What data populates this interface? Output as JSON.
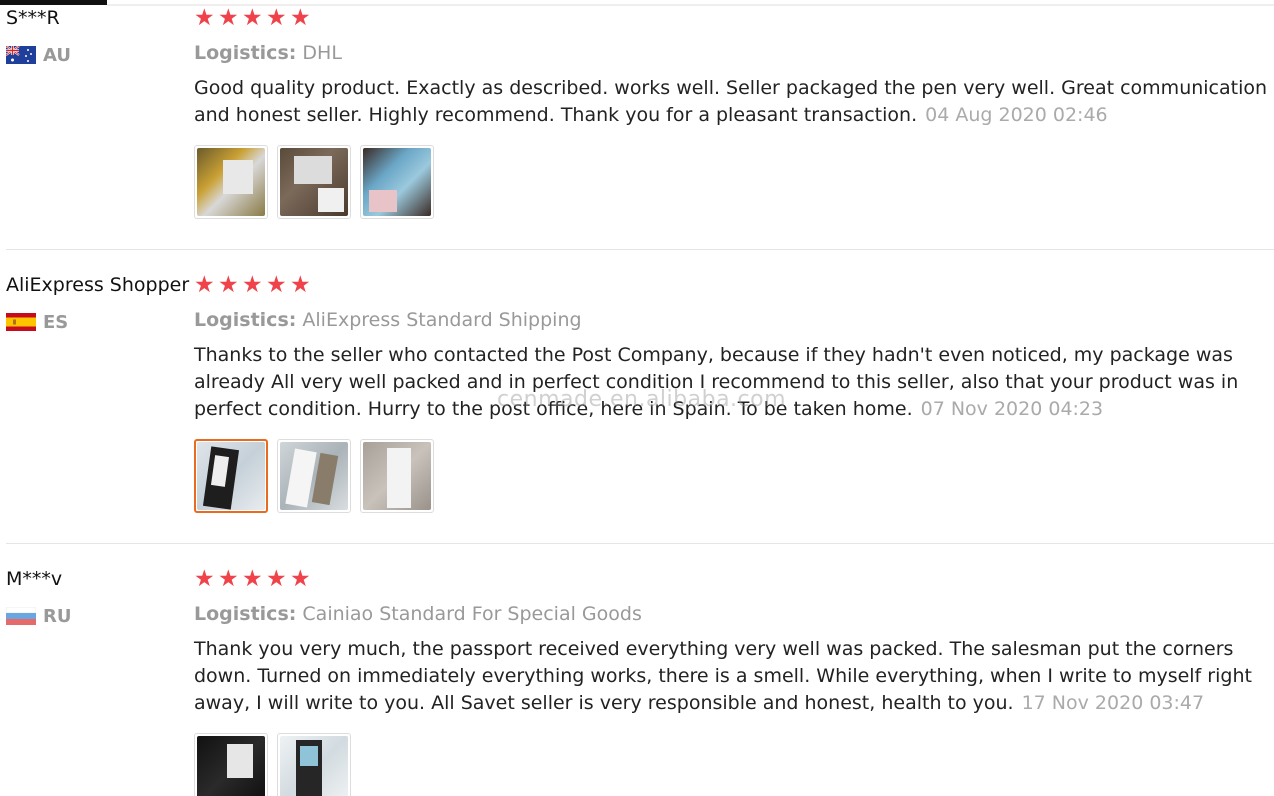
{
  "reviews": [
    {
      "user": "S***R",
      "country": "AU",
      "rating": 5,
      "logistics_label": "Logistics:",
      "logistics": "DHL",
      "text": "Good quality product. Exactly as described. works well. Seller packaged the pen very well. Great communication and honest seller. Highly recommend. Thank you for a pleasant transaction.",
      "date": "04 Aug 2020 02:46",
      "photos": 3
    },
    {
      "user": "AliExpress Shopper",
      "country": "ES",
      "rating": 5,
      "logistics_label": "Logistics:",
      "logistics": "AliExpress Standard Shipping",
      "text": "Thanks to the seller who contacted the Post Company, because if they hadn't even noticed, my package was already All very well packed and in perfect condition I recommend to this seller, also that your product was in perfect condition. Hurry to the post office, here in Spain. To be taken home.",
      "date": "07 Nov 2020 04:23",
      "photos": 3
    },
    {
      "user": "M***v",
      "country": "RU",
      "rating": 5,
      "logistics_label": "Logistics:",
      "logistics": "Cainiao Standard For Special Goods",
      "text": "Thank you very much, the passport received everything very well was packed. The salesman put the corners down. Turned on immediately everything works, there is a smell. While everything, when I write to myself right away, I will write to you. All Savet seller is very responsible and honest, health to you.",
      "date": "17 Nov 2020 03:47",
      "photos": 2
    }
  ],
  "watermark": "cenmade.en.alibaba.com",
  "colors": {
    "star": "#f0424b",
    "selected_thumb_border": "#e86b1f"
  }
}
